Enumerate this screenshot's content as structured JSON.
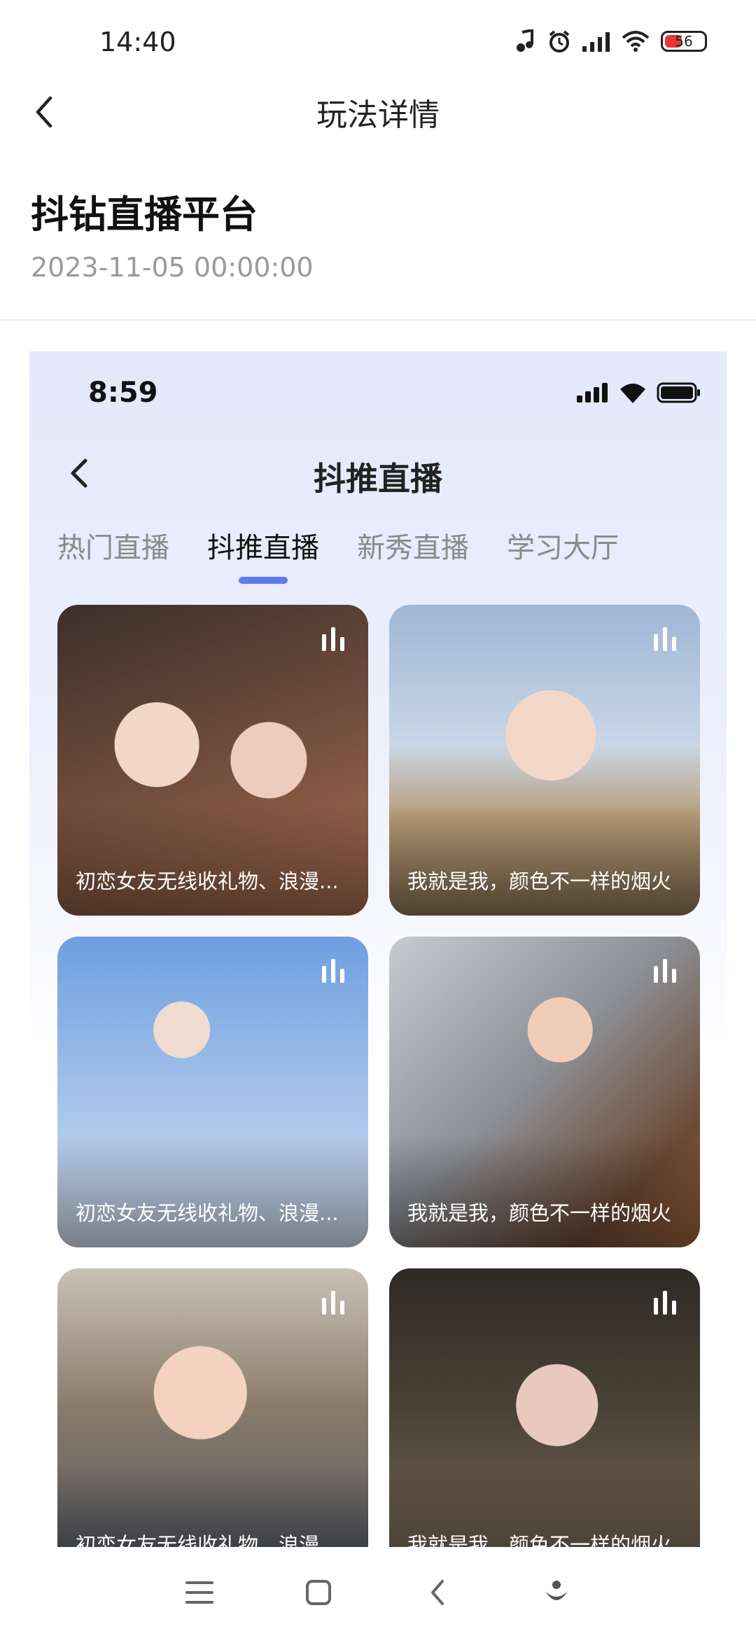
{
  "status_bar": {
    "time": "14:40",
    "battery": "56"
  },
  "nav": {
    "title": "玩法详情"
  },
  "article": {
    "title": "抖钻直播平台",
    "date": "2023-11-05 00:00:00"
  },
  "screenshot": {
    "time": "8:59",
    "title": "抖推直播",
    "tabs": [
      {
        "label": "热门直播",
        "active": false
      },
      {
        "label": "抖推直播",
        "active": true
      },
      {
        "label": "新秀直播",
        "active": false
      },
      {
        "label": "学习大厅",
        "active": false
      }
    ],
    "cards": [
      {
        "caption": "初恋女友无线收礼物、浪漫..."
      },
      {
        "caption": "我就是我，颜色不一样的烟火"
      },
      {
        "caption": "初恋女友无线收礼物、浪漫..."
      },
      {
        "caption": "我就是我，颜色不一样的烟火"
      },
      {
        "caption": "初恋女友无线收礼物、浪漫..."
      },
      {
        "caption": "我就是我，颜色不一样的烟火"
      }
    ],
    "accent_color": "#5b7bf2"
  },
  "icons": {
    "back": "chevron-left-icon",
    "live": "live-bars-icon",
    "system_nav": [
      "menu-icon",
      "home-icon",
      "back-icon",
      "assistant-icon"
    ]
  }
}
